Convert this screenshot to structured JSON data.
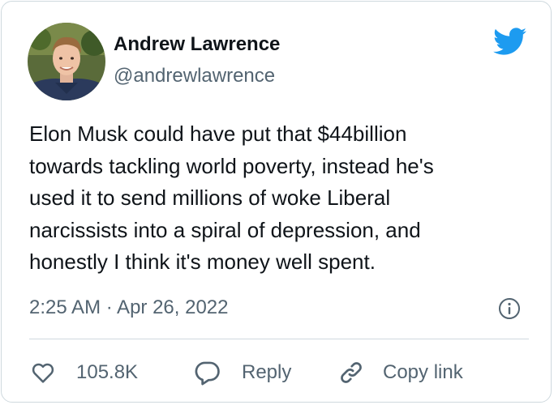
{
  "author": {
    "display_name": "Andrew Lawrence",
    "handle": "@andrewlawrence",
    "avatar_icon": "profile-photo"
  },
  "brand": {
    "icon": "twitter-bird-icon",
    "color": "#1d9bf0"
  },
  "tweet": {
    "lines": [
      "Elon Musk could have put that $44billion",
      "towards tackling world poverty, instead he's",
      "used it to send millions of woke Liberal",
      "narcissists into a spiral of depression, and",
      "honestly I think it's money well spent."
    ],
    "timestamp": "2:25 AM · Apr 26, 2022"
  },
  "actions": {
    "like_count": "105.8K",
    "reply_label": "Reply",
    "copy_link_label": "Copy link"
  },
  "colors": {
    "text_primary": "#0f1419",
    "text_secondary": "#536471",
    "border": "#cfd9de"
  }
}
